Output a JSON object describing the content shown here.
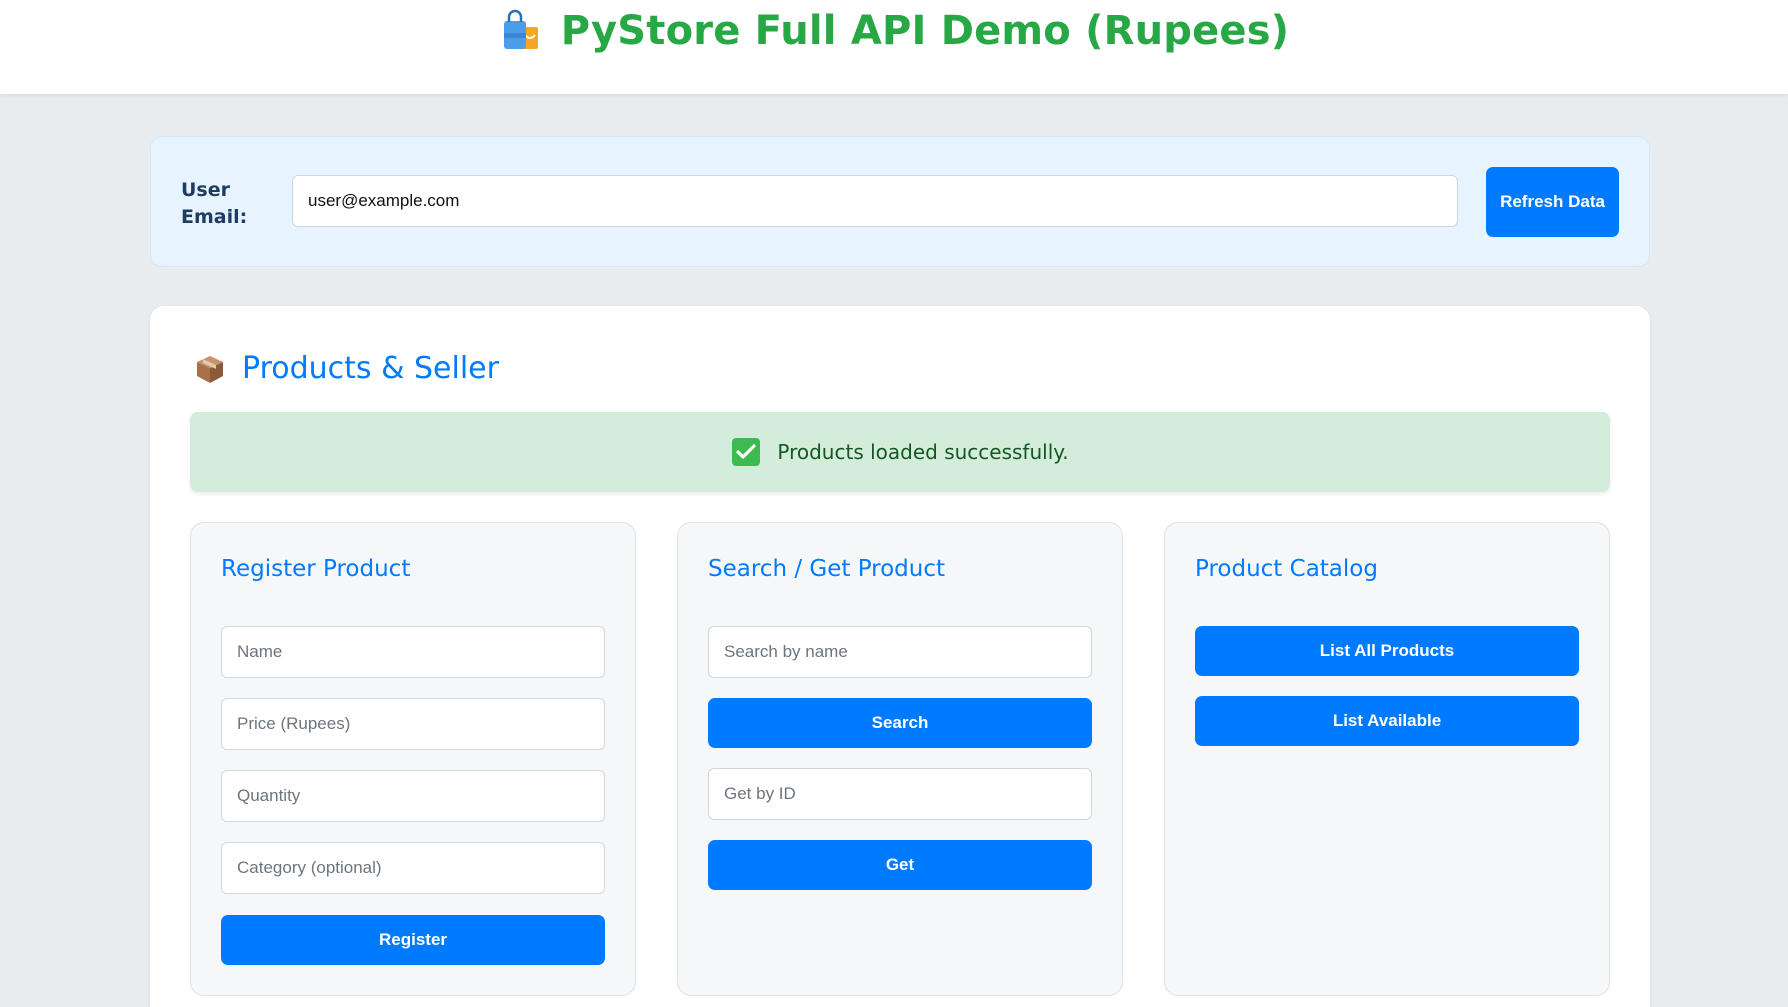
{
  "header": {
    "icon": "shopping-bag-icon",
    "title": "PyStore Full API Demo (Rupees)"
  },
  "user": {
    "label": "User Email:",
    "email_value": "user@example.com",
    "refresh_label": "Refresh Data"
  },
  "products_section": {
    "icon": "package-icon",
    "title": "Products & Seller"
  },
  "alert": {
    "icon": "check-icon",
    "message": "Products loaded successfully."
  },
  "register": {
    "title": "Register Product",
    "name_placeholder": "Name",
    "price_placeholder": "Price (Rupees)",
    "quantity_placeholder": "Quantity",
    "category_placeholder": "Category (optional)",
    "button_label": "Register"
  },
  "search": {
    "title": "Search / Get Product",
    "search_placeholder": "Search by name",
    "search_button": "Search",
    "id_placeholder": "Get by ID",
    "get_button": "Get"
  },
  "catalog": {
    "title": "Product Catalog",
    "list_all_button": "List All Products",
    "list_available_button": "List Available"
  },
  "colors": {
    "title_green": "#28a745",
    "primary_blue": "#007bff",
    "success_bg": "#d4edda",
    "page_bg": "#e9ecef"
  }
}
